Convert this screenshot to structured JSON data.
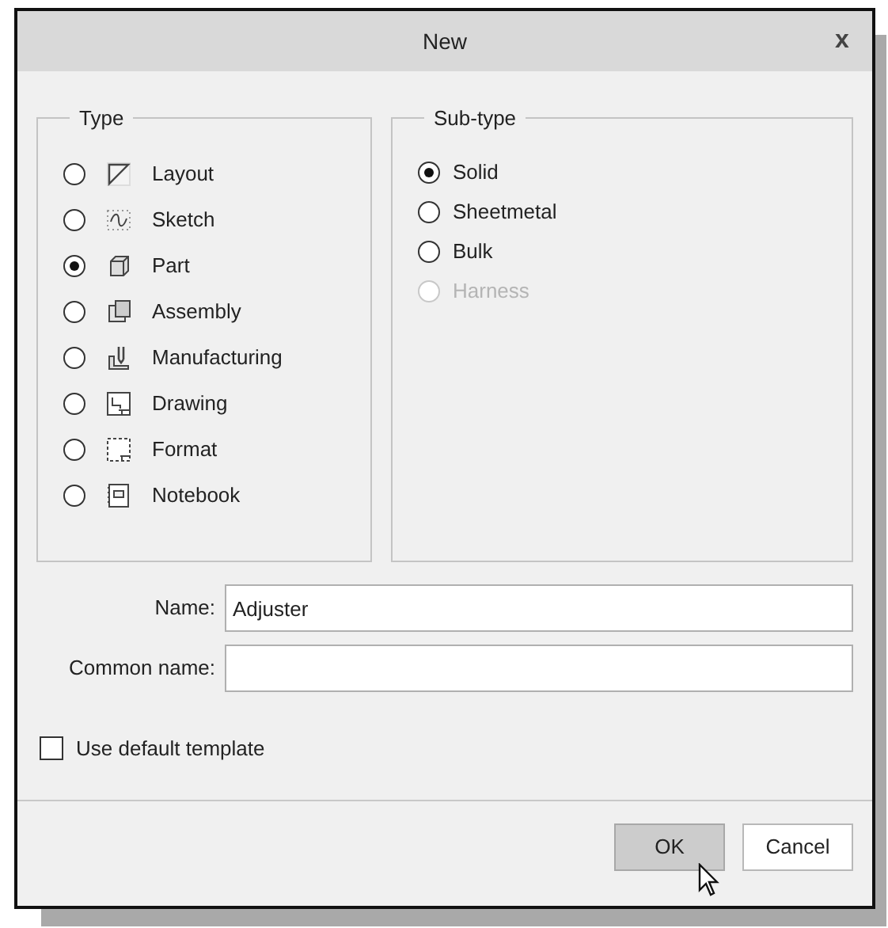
{
  "window": {
    "title": "New",
    "close": "x"
  },
  "type_group": {
    "title": "Type",
    "items": [
      {
        "label": "Layout",
        "kind": "layout",
        "selected": false
      },
      {
        "label": "Sketch",
        "kind": "sketch",
        "selected": false
      },
      {
        "label": "Part",
        "kind": "part",
        "selected": true
      },
      {
        "label": "Assembly",
        "kind": "assembly",
        "selected": false
      },
      {
        "label": "Manufacturing",
        "kind": "manufacturing",
        "selected": false
      },
      {
        "label": "Drawing",
        "kind": "drawing",
        "selected": false
      },
      {
        "label": "Format",
        "kind": "format",
        "selected": false
      },
      {
        "label": "Notebook",
        "kind": "notebook",
        "selected": false
      }
    ]
  },
  "subtype_group": {
    "title": "Sub-type",
    "items": [
      {
        "label": "Solid",
        "selected": true,
        "disabled": false
      },
      {
        "label": "Sheetmetal",
        "selected": false,
        "disabled": false
      },
      {
        "label": "Bulk",
        "selected": false,
        "disabled": false
      },
      {
        "label": "Harness",
        "selected": false,
        "disabled": true
      }
    ]
  },
  "fields": [
    {
      "label": "Name:",
      "value": "Adjuster"
    },
    {
      "label": "Common name:"
    }
  ],
  "use_default_template": {
    "label": "Use default template",
    "checked": false
  },
  "buttons": [
    {
      "label": "OK",
      "hovered": true
    },
    {
      "label": "Cancel",
      "hovered": false
    }
  ]
}
